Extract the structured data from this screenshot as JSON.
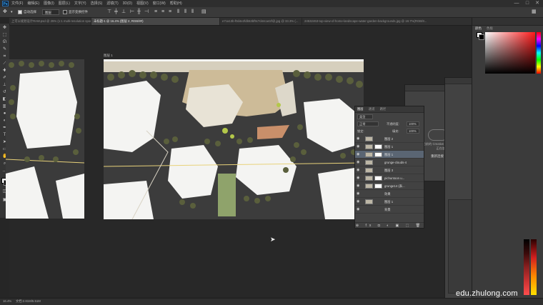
{
  "menubar": {
    "logo": "Ps",
    "items": [
      "文件(F)",
      "编辑(E)",
      "图像(I)",
      "图层(L)",
      "文字(Y)",
      "选择(S)",
      "滤镜(T)",
      "3D(D)",
      "视图(V)",
      "窗口(W)",
      "帮助(H)"
    ],
    "minimize": "—",
    "maximize": "□",
    "close": "✕"
  },
  "options": {
    "auto_select": "自动选择",
    "target": "图层",
    "show_transform": "显示变换控件"
  },
  "tabs": [
    {
      "label": "上可以规划设计RAW.psd @ 25% (1:1 multi-resolution spongy-black and...",
      "active": false
    },
    {
      "label": "未标题-1 @ 16.4% (图层 2, RGB/8#)",
      "active": true
    },
    {
      "label": "e7ca13b-f0d4e2fdb53bf9c7d44ca42f@.jpg @ 33.3% (...",
      "active": false
    },
    {
      "label": "24532463-top-view-of-home-landscape-water-garden-backgrounds.jpg @ 18.7%(RGB/8...",
      "active": false
    }
  ],
  "doc_label": "图层 1",
  "layers_panel": {
    "tabs": [
      "图层",
      "通道",
      "路径"
    ],
    "kind_label": "类型",
    "blend_mode": "正常",
    "opacity_label": "不透明度:",
    "opacity_value": "100%",
    "lock_label": "锁定:",
    "fill_label": "填充:",
    "fill_value": "100%",
    "rows": [
      {
        "name": "图层 2",
        "selected": false,
        "group": true
      },
      {
        "name": "图层 1",
        "selected": false,
        "group": false
      },
      {
        "name": "图层 1",
        "selected": true,
        "group": true
      },
      {
        "name": "grunge-clouds-4",
        "selected": false,
        "group": false
      },
      {
        "name": "图层 3",
        "selected": false,
        "group": false
      },
      {
        "name": "pichuntoon u...",
        "selected": false,
        "group": false
      },
      {
        "name": "grunge14 (表...",
        "selected": false,
        "group": false
      },
      {
        "name": "效果",
        "selected": false,
        "group": false
      },
      {
        "name": "图层 1",
        "selected": false,
        "group": false
      },
      {
        "name": "背景",
        "selected": false,
        "group": false
      }
    ]
  },
  "libraries": {
    "message": "您目前的 Creative Cloud Libraries 正在加载",
    "retry": "重新连接"
  },
  "color_panel": {
    "tabs": [
      "颜色",
      "色板"
    ]
  },
  "status": {
    "zoom": "16.4%",
    "doc": "文档:2.81M/5.51M"
  },
  "watermark": "edu.zhulong.com",
  "colors": {
    "ui_bg": "#262626",
    "panel": "#424242",
    "road": "#3a3a3a",
    "building": "#f4f4f2",
    "accent_red": "#d42020"
  }
}
